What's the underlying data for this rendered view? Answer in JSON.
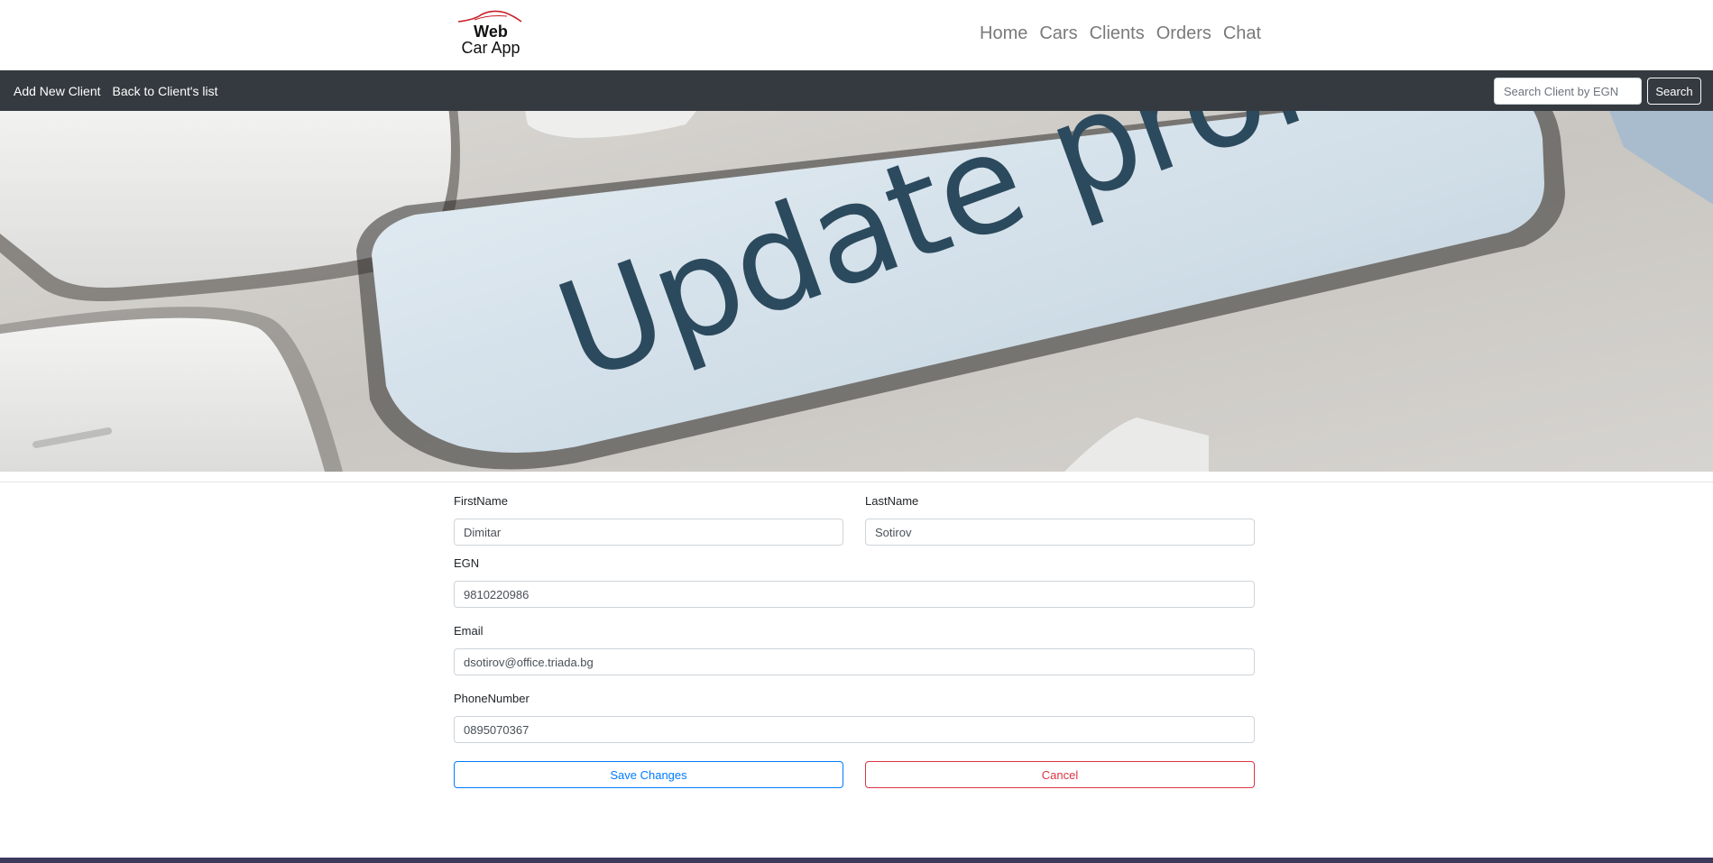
{
  "header": {
    "logo_line1": "Web",
    "logo_line2": "Car App",
    "nav": [
      "Home",
      "Cars",
      "Clients",
      "Orders",
      "Chat"
    ]
  },
  "subnav": {
    "links": [
      "Add New Client",
      "Back to Client's list"
    ],
    "search_placeholder": "Search Client by EGN",
    "search_button": "Search"
  },
  "hero": {
    "text": "Update profile"
  },
  "form": {
    "first_name": {
      "label": "FirstName",
      "value": "Dimitar"
    },
    "last_name": {
      "label": "LastName",
      "value": "Sotirov"
    },
    "egn": {
      "label": "EGN",
      "value": "9810220986"
    },
    "email": {
      "label": "Email",
      "value": "dsotirov@office.triada.bg"
    },
    "phone": {
      "label": "PhoneNumber",
      "value": "0895070367"
    },
    "save_label": "Save Changes",
    "cancel_label": "Cancel"
  },
  "colors": {
    "subnav_bg": "#343a40",
    "primary": "#007bff",
    "danger": "#dc3545",
    "footer": "#3d3a5c"
  }
}
